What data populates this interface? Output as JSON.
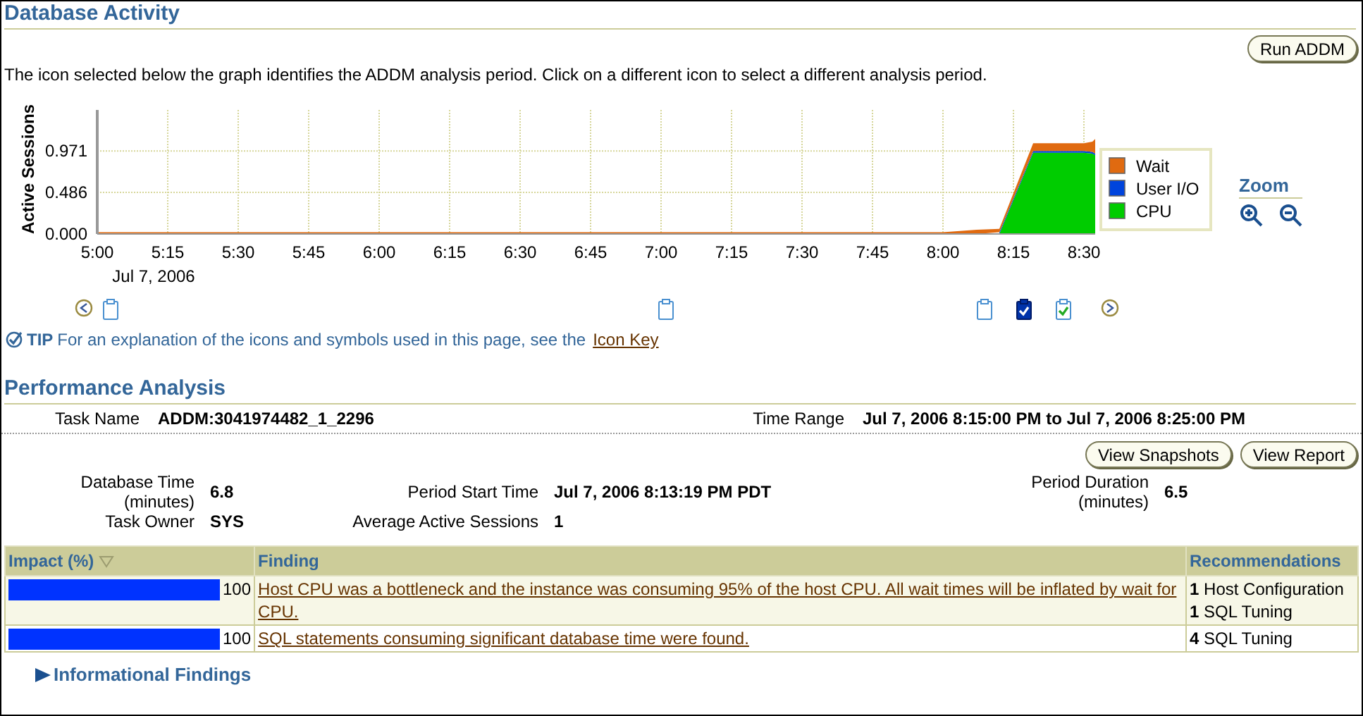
{
  "activity": {
    "title": "Database Activity",
    "run_button": "Run ADDM",
    "instructions": "The icon selected below the graph identifies the ADDM analysis period. Click on a different icon to select a different analysis period.",
    "chart_date": "Jul 7, 2006",
    "chart_data": {
      "type": "area",
      "stacked": true,
      "ylabel": "Active Sessions",
      "x": [
        5,
        8,
        8.12,
        8.2,
        8.32,
        8.5,
        8.53,
        8.54
      ],
      "series": [
        {
          "name": "CPU",
          "color": "#00cc00",
          "values": [
            0,
            0,
            0,
            0,
            0.95,
            0.95,
            0.94,
            0.92
          ]
        },
        {
          "name": "User I/O",
          "color": "#0044dd",
          "values": [
            null,
            null,
            null,
            0.02,
            0.02,
            0.02,
            0.02,
            0.02
          ]
        },
        {
          "name": "Wait",
          "color": "#e06a10",
          "values": [
            0.02,
            0.02,
            0.05,
            0.04,
            0.09,
            0.09,
            0.12,
            0.17
          ]
        }
      ],
      "xlim": [
        5,
        8.54
      ],
      "ylim": [
        0,
        1.45
      ],
      "grid": true,
      "legend": true,
      "xticks": [
        {
          "value": 5,
          "label": "5:00"
        },
        {
          "value": 5.25,
          "label": "5:15"
        },
        {
          "value": 5.5,
          "label": "5:30"
        },
        {
          "value": 5.75,
          "label": "5:45"
        },
        {
          "value": 6,
          "label": "6:00"
        },
        {
          "value": 6.25,
          "label": "6:15"
        },
        {
          "value": 6.5,
          "label": "6:30"
        },
        {
          "value": 6.75,
          "label": "6:45"
        },
        {
          "value": 7,
          "label": "7:00"
        },
        {
          "value": 7.25,
          "label": "7:15"
        },
        {
          "value": 7.5,
          "label": "7:30"
        },
        {
          "value": 7.75,
          "label": "7:45"
        },
        {
          "value": 8,
          "label": "8:00"
        },
        {
          "value": 8.25,
          "label": "8:15"
        },
        {
          "value": 8.5,
          "label": "8:30"
        }
      ],
      "yticks": [
        {
          "value": 0,
          "label": "0.000"
        },
        {
          "value": 0.486,
          "label": "0.486"
        },
        {
          "value": 0.971,
          "label": "0.971"
        }
      ]
    },
    "zoom": {
      "label": "Zoom"
    },
    "snapshots": [
      {
        "kind": "prev"
      },
      {
        "kind": "snapshot",
        "selected": false,
        "checked": false
      },
      {
        "kind": "snapshot",
        "selected": false,
        "checked": false
      },
      {
        "kind": "snapshot",
        "selected": false,
        "checked": false
      },
      {
        "kind": "snapshot",
        "selected": true,
        "checked": true
      },
      {
        "kind": "snapshot",
        "selected": false,
        "checked": true
      },
      {
        "kind": "next"
      }
    ],
    "tip": {
      "label": "TIP",
      "text": "For an explanation of the icons and symbols used in this page, see the",
      "link": "Icon Key"
    }
  },
  "performance": {
    "title": "Performance Analysis",
    "task": [
      {
        "label": "Task Name",
        "value": "ADDM:3041974482_1_2296"
      },
      {
        "label": "Time Range",
        "value": "Jul 7, 2006 8:15:00 PM to Jul 7, 2006 8:25:00 PM"
      }
    ],
    "buttons": [
      "View Snapshots",
      "View Report"
    ],
    "details": [
      {
        "label": "Database Time (minutes)",
        "value": "6.8"
      },
      {
        "label": "Period Start Time",
        "value": "Jul 7, 2006 8:13:19 PM PDT"
      },
      {
        "label": "Period Duration (minutes)",
        "value": "6.5"
      },
      {
        "label": "Task Owner",
        "value": "SYS"
      },
      {
        "label": "Average Active Sessions",
        "value": "1"
      }
    ],
    "table": {
      "columns": [
        {
          "label": "Impact (%)",
          "sorted": true
        },
        {
          "label": "Finding",
          "sorted": false
        },
        {
          "label": "Recommendations",
          "sorted": false
        }
      ],
      "rows": [
        {
          "impact": "100",
          "finding": "Host CPU was a bottleneck and the instance was consuming 95% of the host CPU. All wait times will be inflated by wait for CPU.",
          "recommendations": [
            "**1** Host Configuration",
            "**1** SQL Tuning"
          ]
        },
        {
          "impact": "100",
          "finding": "SQL statements consuming significant database time were found.",
          "recommendations": [
            "**4** SQL Tuning"
          ]
        }
      ]
    },
    "informational": {
      "label": "Informational Findings",
      "expanded": false
    }
  }
}
